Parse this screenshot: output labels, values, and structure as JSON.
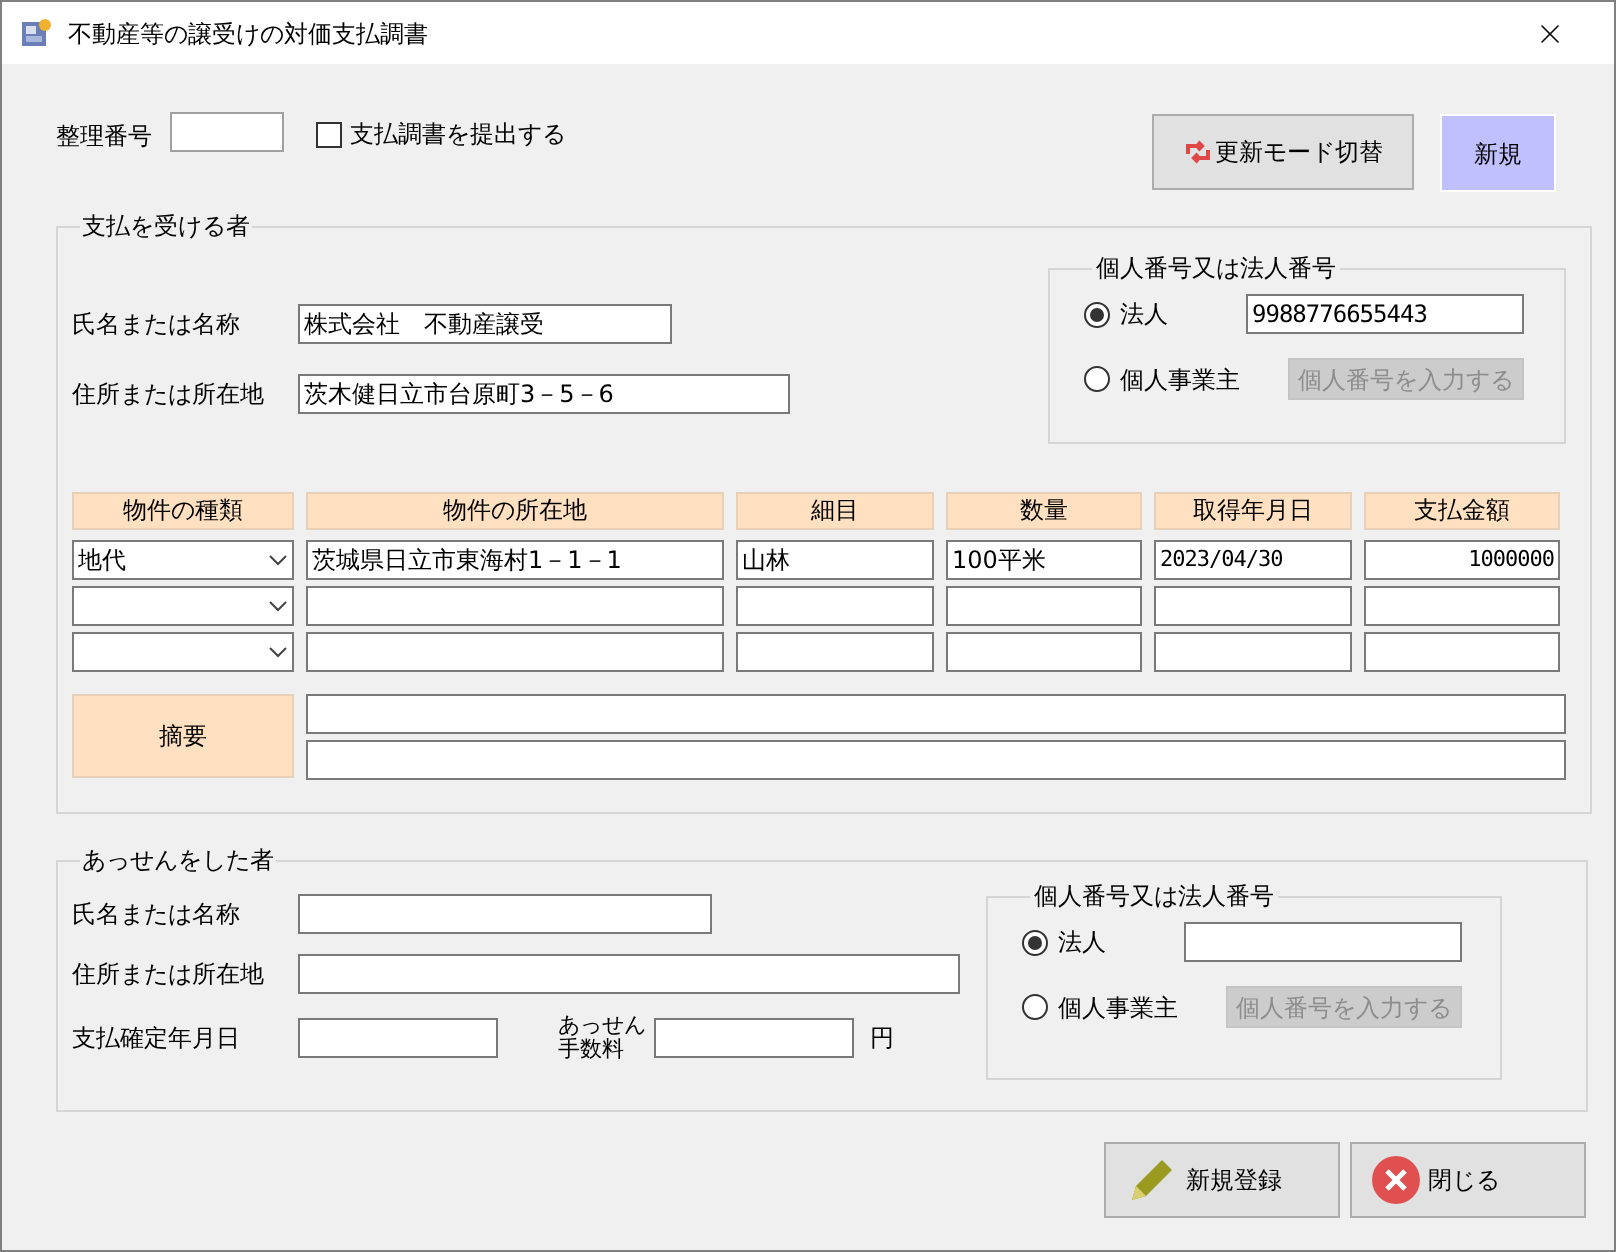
{
  "window": {
    "title": "不動産等の譲受けの対価支払調書"
  },
  "header": {
    "number_label": "整理番号",
    "submit_checkbox": {
      "label": "支払調書を提出する",
      "checked": false
    },
    "buttons": [
      {
        "label": "更新モード切替",
        "kind": "mode"
      },
      {
        "label": "新規",
        "kind": "status"
      }
    ]
  },
  "payee": {
    "title": "支払を受ける者",
    "fields": [
      {
        "label": "氏名または名称",
        "value": "株式会社　不動産譲受",
        "kind": "short"
      },
      {
        "label": "住所または所在地",
        "value": "茨木健日立市台原町3－5－6",
        "kind": "long"
      }
    ],
    "id_group": {
      "title": "個人番号又は法人番号",
      "corp_number": "9988776655443",
      "options": [
        {
          "label": "法人",
          "selected": true
        },
        {
          "label": "個人事業主",
          "selected": false
        }
      ],
      "personal_button": {
        "label": "個人番号を入力する",
        "disabled": true
      }
    }
  },
  "property_table": {
    "columns": [
      "物件の種類",
      "物件の所在地",
      "細目",
      "数量",
      "取得年月日",
      "支払金額"
    ],
    "rows": [
      {
        "cells": [
          "地代",
          "茨城県日立市東海村1－1－1",
          "山林",
          "100平米",
          "2023/04/30",
          "1000000"
        ]
      },
      {
        "cells": []
      },
      {
        "cells": []
      }
    ],
    "summary_label": "摘要"
  },
  "broker": {
    "title": "あっせんをした者",
    "fields": [
      {
        "label": "氏名または名称",
        "kind": "short"
      },
      {
        "label": "住所または所在地",
        "kind": "long"
      }
    ],
    "date_label": "支払確定年月日",
    "fee_label": "あっせん手数料",
    "yen": "円",
    "id_group": {
      "title": "個人番号又は法人番号",
      "options": [
        {
          "label": "法人",
          "selected": true
        },
        {
          "label": "個人事業主",
          "selected": false
        }
      ],
      "personal_button": {
        "label": "個人番号を入力する",
        "disabled": true
      }
    }
  },
  "footer_buttons": [
    {
      "label": "新規登録",
      "kind": "register"
    },
    {
      "label": "閉じる",
      "kind": "close"
    }
  ]
}
